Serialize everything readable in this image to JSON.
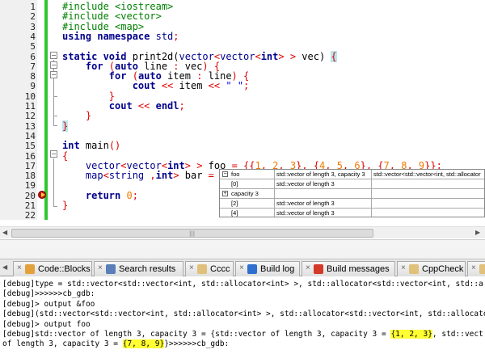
{
  "editor": {
    "line_numbers": [
      "1",
      "2",
      "3",
      "4",
      "5",
      "6",
      "7",
      "8",
      "9",
      "10",
      "11",
      "12",
      "13",
      "14",
      "15",
      "16",
      "17",
      "18",
      "19",
      "20",
      "21",
      "22"
    ],
    "lines": [
      [
        {
          "t": "#include <iostream>",
          "c": "pp"
        }
      ],
      [
        {
          "t": "#include <vector>",
          "c": "pp"
        }
      ],
      [
        {
          "t": "#include <map>",
          "c": "pp"
        }
      ],
      [
        {
          "t": "using namespace ",
          "c": "kw"
        },
        {
          "t": "std",
          "c": "tp"
        },
        {
          "t": ";",
          "c": "op"
        }
      ],
      [],
      [
        {
          "t": "static void ",
          "c": "kw"
        },
        {
          "t": "print2d(",
          "c": ""
        },
        {
          "t": "vector",
          "c": "tp"
        },
        {
          "t": "<",
          "c": "op"
        },
        {
          "t": "vector",
          "c": "tp"
        },
        {
          "t": "<",
          "c": "op"
        },
        {
          "t": "int",
          "c": "kw"
        },
        {
          "t": "> > ",
          "c": "op"
        },
        {
          "t": "vec) ",
          "c": ""
        },
        {
          "t": "{",
          "c": "brhl"
        }
      ],
      [
        {
          "t": "    for ",
          "c": "kw"
        },
        {
          "t": "(",
          "c": "op"
        },
        {
          "t": "auto ",
          "c": "kw"
        },
        {
          "t": "line ",
          "c": ""
        },
        {
          "t": ": ",
          "c": "op"
        },
        {
          "t": "vec",
          "c": ""
        },
        {
          "t": ") {",
          "c": "op"
        }
      ],
      [
        {
          "t": "        for ",
          "c": "kw"
        },
        {
          "t": "(",
          "c": "op"
        },
        {
          "t": "auto ",
          "c": "kw"
        },
        {
          "t": "item ",
          "c": ""
        },
        {
          "t": ": ",
          "c": "op"
        },
        {
          "t": "line",
          "c": ""
        },
        {
          "t": ") {",
          "c": "op"
        }
      ],
      [
        {
          "t": "            cout ",
          "c": "kw"
        },
        {
          "t": "<< ",
          "c": "op"
        },
        {
          "t": "item ",
          "c": ""
        },
        {
          "t": "<< ",
          "c": "op"
        },
        {
          "t": "\" \"",
          "c": "str"
        },
        {
          "t": ";",
          "c": "op"
        }
      ],
      [
        {
          "t": "        }",
          "c": "op"
        }
      ],
      [
        {
          "t": "        cout ",
          "c": "kw"
        },
        {
          "t": "<< ",
          "c": "op"
        },
        {
          "t": "endl",
          "c": "kw"
        },
        {
          "t": ";",
          "c": "op"
        }
      ],
      [
        {
          "t": "    }",
          "c": "op"
        }
      ],
      [
        {
          "t": "}",
          "c": "brhl"
        }
      ],
      [],
      [
        {
          "t": "int ",
          "c": "kw"
        },
        {
          "t": "main",
          "c": ""
        },
        {
          "t": "()",
          "c": "op"
        }
      ],
      [
        {
          "t": "{",
          "c": "op"
        }
      ],
      [
        {
          "t": "    vector",
          "c": "tp"
        },
        {
          "t": "<",
          "c": "op"
        },
        {
          "t": "vector",
          "c": "tp"
        },
        {
          "t": "<",
          "c": "op"
        },
        {
          "t": "int",
          "c": "kw"
        },
        {
          "t": "> > ",
          "c": "op"
        },
        {
          "t": "foo ",
          "c": ""
        },
        {
          "t": "= {{",
          "c": "op"
        },
        {
          "t": "1",
          "c": "num"
        },
        {
          "t": ", ",
          "c": "op"
        },
        {
          "t": "2",
          "c": "num"
        },
        {
          "t": ", ",
          "c": "op"
        },
        {
          "t": "3",
          "c": "num"
        },
        {
          "t": "}, {",
          "c": "op"
        },
        {
          "t": "4",
          "c": "num"
        },
        {
          "t": ", ",
          "c": "op"
        },
        {
          "t": "5",
          "c": "num"
        },
        {
          "t": ", ",
          "c": "op"
        },
        {
          "t": "6",
          "c": "num"
        },
        {
          "t": "}, {",
          "c": "op"
        },
        {
          "t": "7",
          "c": "num"
        },
        {
          "t": ", ",
          "c": "op"
        },
        {
          "t": "8",
          "c": "num"
        },
        {
          "t": ", ",
          "c": "op"
        },
        {
          "t": "9",
          "c": "num"
        },
        {
          "t": "}};",
          "c": "op"
        }
      ],
      [
        {
          "t": "    map",
          "c": "tp"
        },
        {
          "t": "<",
          "c": "op"
        },
        {
          "t": "string ",
          "c": "tp"
        },
        {
          "t": ",",
          "c": "op"
        },
        {
          "t": "int",
          "c": "kw"
        },
        {
          "t": "> ",
          "c": "op"
        },
        {
          "t": "bar ",
          "c": ""
        },
        {
          "t": "= {",
          "c": "op"
        }
      ],
      [],
      [
        {
          "t": "    return ",
          "c": "kw"
        },
        {
          "t": "0",
          "c": "num"
        },
        {
          "t": ";",
          "c": "op"
        }
      ],
      [
        {
          "t": "}",
          "c": "op"
        }
      ],
      []
    ]
  },
  "watch": {
    "rows": [
      {
        "name": "foo",
        "value": "std::vector of length 3, capacity 3",
        "type": "std::vector<std::vector<int, std::allocator",
        "toggle": "−"
      },
      {
        "name": "[0]",
        "value": "std::vector of length 3",
        "type": "",
        "toggle": ""
      },
      {
        "name": "capacity 3",
        "value": "",
        "type": "",
        "toggle": "+"
      },
      {
        "name": "[2]",
        "value": "std::vector of length 3",
        "type": "",
        "toggle": ""
      },
      {
        "name": "[4]",
        "value": "std::vector of length 3",
        "type": "",
        "toggle": ""
      }
    ]
  },
  "tabs": [
    {
      "label": "Code::Blocks",
      "icon_color": "#e2a23b",
      "icon": "codeblocks-icon"
    },
    {
      "label": "Search results",
      "icon_color": "#5a7fb8",
      "icon": "search-icon"
    },
    {
      "label": "Cccc",
      "icon_color": "#e0c07a",
      "icon": "document-icon"
    },
    {
      "label": "Build log",
      "icon_color": "#2f6fd0",
      "icon": "gear-icon"
    },
    {
      "label": "Build messages",
      "icon_color": "#d33a2a",
      "icon": "build-messages-icon"
    },
    {
      "label": "CppCheck",
      "icon_color": "#e0c07a",
      "icon": "document-icon"
    },
    {
      "label": "C",
      "icon_color": "#e0c07a",
      "icon": "document-icon"
    }
  ],
  "log": {
    "lines": [
      [
        {
          "t": "[debug]type = std::vector<std::vector<int, std::allocator<int> >, std::allocator<std::vector<int, std::a",
          "h": false
        }
      ],
      [
        {
          "t": "[debug]>>>>>>cb_gdb:",
          "h": false
        }
      ],
      [
        {
          "t": "[debug]> output &foo",
          "h": false
        }
      ],
      [
        {
          "t": "[debug](std::vector<std::vector<int, std::allocator<int> >, std::allocator<std::vector<int, std::allocato",
          "h": false
        }
      ],
      [
        {
          "t": "[debug]> output foo",
          "h": false
        }
      ],
      [
        {
          "t": "[debug]std::vector of length 3, capacity 3 = {std::vector of length 3, capacity 3 = ",
          "h": false
        },
        {
          "t": "{1, 2, 3}",
          "h": true
        },
        {
          "t": ", std::vect",
          "h": false
        }
      ],
      [
        {
          "t": "of length 3, capacity 3 = ",
          "h": false
        },
        {
          "t": "{7, 8, 9}",
          "h": true
        },
        {
          "t": "}>>>>>>cb_gdb:",
          "h": false
        }
      ]
    ]
  },
  "colors": {
    "breakpoint": "#cc1010",
    "changebar": "#2fc72f",
    "highlight": "#ffff33",
    "brace_match": "#b8e7ee"
  }
}
